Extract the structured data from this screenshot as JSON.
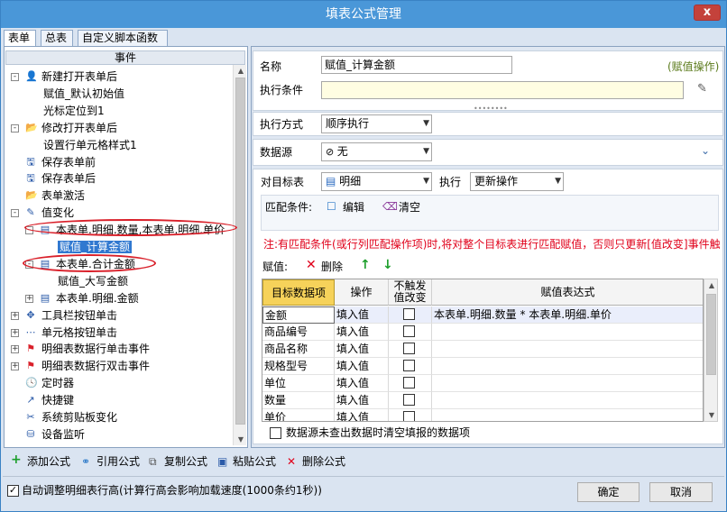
{
  "window": {
    "title": "填表公式管理",
    "close": "x"
  },
  "tabs": [
    {
      "label": "表单"
    },
    {
      "label": "总表"
    },
    {
      "label": "自定义脚本函数"
    }
  ],
  "tree": {
    "header": "事件",
    "nodes": [
      {
        "label": "新建打开表单后",
        "exp": "-",
        "icon": "user-add-icon",
        "glyph": "👤"
      },
      {
        "label": "赋值_默认初始值"
      },
      {
        "label": "光标定位到1"
      },
      {
        "label": "修改打开表单后",
        "exp": "-",
        "icon": "folder-icon",
        "glyph": "📂"
      },
      {
        "label": "设置行单元格样式1"
      },
      {
        "label": "保存表单前",
        "icon": "save-icon",
        "glyph": "🖫"
      },
      {
        "label": "保存表单后",
        "icon": "save-icon",
        "glyph": "🖫"
      },
      {
        "label": "表单激活",
        "icon": "folder-icon",
        "glyph": "📂"
      },
      {
        "label": "值变化",
        "exp": "-",
        "icon": "edit-icon",
        "glyph": "✎"
      },
      {
        "label": "本表单.明细.数量,本表单.明细.单价",
        "exp": "-",
        "icon": "table-icon",
        "glyph": "▤"
      },
      {
        "label": "赋值_计算金额",
        "selected": true
      },
      {
        "label": "本表单.合计金额",
        "exp": "-",
        "icon": "table-icon",
        "glyph": "▤"
      },
      {
        "label": "赋值_大写金额"
      },
      {
        "label": "本表单.明细.金额",
        "exp": "+",
        "icon": "table-icon",
        "glyph": "▤"
      },
      {
        "label": "工具栏按钮单击",
        "exp": "+",
        "icon": "toolbar-icon",
        "glyph": "✥"
      },
      {
        "label": "单元格按钮单击",
        "exp": "+",
        "icon": "dots-icon",
        "glyph": "⋯"
      },
      {
        "label": "明细表数据行单击事件",
        "exp": "+",
        "icon": "flag-icon",
        "glyph": "⚑"
      },
      {
        "label": "明细表数据行双击事件",
        "exp": "+",
        "icon": "flag-icon",
        "glyph": "⚑"
      },
      {
        "label": "定时器",
        "icon": "timer-icon",
        "glyph": "🕓"
      },
      {
        "label": "快捷键",
        "icon": "shortcut-icon",
        "glyph": "↗"
      },
      {
        "label": "系统剪贴板变化",
        "icon": "scissors-icon",
        "glyph": "✂"
      },
      {
        "label": "设备监听",
        "icon": "device-icon",
        "glyph": "⛁"
      }
    ]
  },
  "form": {
    "name_label": "名称",
    "name_value": "赋值_计算金额",
    "op_type": "(赋值操作)",
    "cond_label": "执行条件",
    "cond_value": "",
    "mode_label": "执行方式",
    "mode_value": "顺序执行",
    "ds_label": "数据源",
    "ds_value": "无",
    "target_label": "对目标表",
    "target_value": "明细",
    "exec_label": "执行",
    "exec_value": "更新操作",
    "match_label": "匹配条件:",
    "edit_label": "编辑",
    "clear_label": "清空",
    "note": "注:有匹配条件(或行列匹配操作项)时,将对整个目标表进行匹配赋值，否则只更新[值改变]事件触",
    "assign_label": "赋值:",
    "delete_label": "删除",
    "footer_check_label": "数据源未查出数据时清空填报的数据项"
  },
  "grid": {
    "headers": [
      "目标数据项",
      "操作",
      "不触发值改变",
      "赋值表达式"
    ],
    "rows": [
      {
        "target": "金额",
        "op": "填入值",
        "expr": "本表单.明细.数量 * 本表单.明细.单价"
      },
      {
        "target": "商品编号",
        "op": "填入值",
        "expr": ""
      },
      {
        "target": "商品名称",
        "op": "填入值",
        "expr": ""
      },
      {
        "target": "规格型号",
        "op": "填入值",
        "expr": ""
      },
      {
        "target": "单位",
        "op": "填入值",
        "expr": ""
      },
      {
        "target": "数量",
        "op": "填入值",
        "expr": ""
      },
      {
        "target": "单价",
        "op": "填入值",
        "expr": ""
      }
    ]
  },
  "toolbar": {
    "add": "添加公式",
    "ref": "引用公式",
    "copy": "复制公式",
    "paste": "粘贴公式",
    "del": "删除公式"
  },
  "bottom": {
    "auto_check": "自动调整明细表行高(计算行高会影响加载速度(1000条约1秒))",
    "ok": "确定",
    "cancel": "取消"
  },
  "colors": {
    "title_bar": "#4a97d8",
    "selected": "#3078d0",
    "note_red": "#e0001a",
    "add_green": "#1c9e2a",
    "delete_red": "#e0001a"
  }
}
